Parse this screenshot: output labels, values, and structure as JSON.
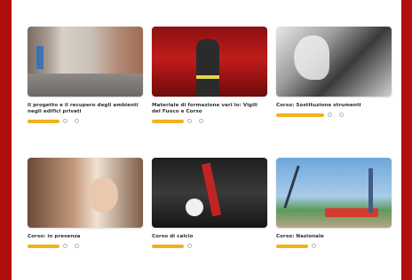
{
  "cards": [
    {
      "title": "Il progetto e il recupero degli ambienti negli edifici privati",
      "badge": "",
      "meta1": "",
      "meta2": "",
      "thumb_icon": "hallway-photo"
    },
    {
      "title": "Materiale di formazione vari lo: Vigili del Fuoco e Corso",
      "badge": "",
      "meta1": "",
      "meta2": "",
      "thumb_icon": "firefighter-photo"
    },
    {
      "title": "Corso: Sostituzione strumenti",
      "badge": "",
      "meta1": "",
      "meta2": "",
      "thumb_icon": "sketch-photo"
    },
    {
      "title": "Corso: in presenza",
      "badge": "",
      "meta1": "",
      "meta2": "",
      "thumb_icon": "people-photo"
    },
    {
      "title": "Corso di calcio",
      "badge": "",
      "meta1": "",
      "meta2": "",
      "thumb_icon": "football-photo"
    },
    {
      "title": "Corso: Nazionale",
      "badge": "",
      "meta1": "",
      "meta2": "",
      "thumb_icon": "harbor-photo"
    }
  ],
  "colors": {
    "frame_bg": "#b10e0e",
    "badge": "#f0b21e",
    "card_bg": "#ffffff"
  }
}
